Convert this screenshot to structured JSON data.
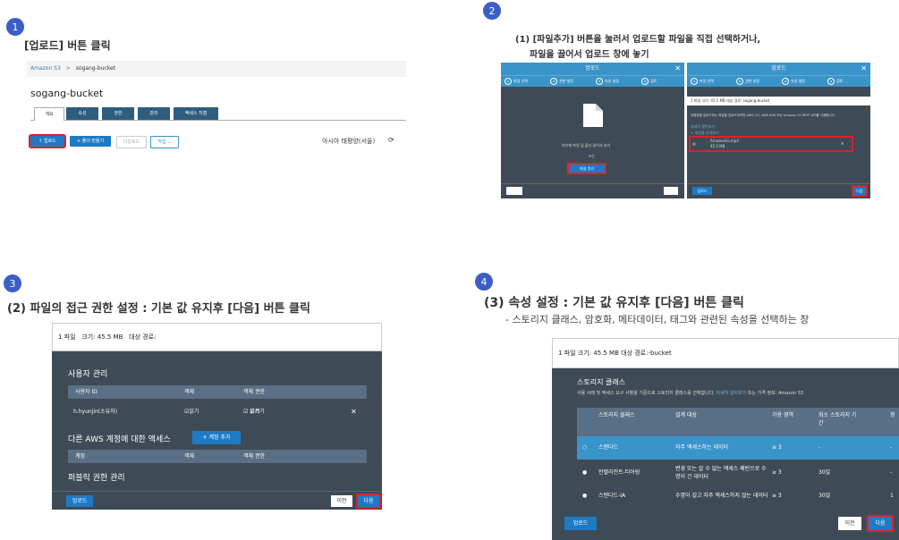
{
  "steps": {
    "s1": {
      "num": "1",
      "heading": "[업로드] 버튼 클릭"
    },
    "s2": {
      "num": "2",
      "line1": "(1) [파일추가] 버튼을 눌러서 업로드할 파일을 직접 선택하거나,",
      "line2": "파일을 끌어서 업로드 창에 놓기"
    },
    "s3": {
      "num": "3",
      "heading": "(2) 파일의 접근 권한 설정 : 기본 값 유지후 [다음] 버튼 클릭"
    },
    "s4": {
      "num": "4",
      "heading": "(3) 속성 설정 : 기본 값 유지후 [다음] 버튼 클릭",
      "sub": "- 스토리지 클래스, 암호화, 메타데이터, 태그와 관련된 속성을 선택하는 창"
    }
  },
  "panel1": {
    "crumb_root": "Amazon S3",
    "crumb_sep": ">",
    "crumb_current": "sogang-bucket",
    "bucket_title": "sogang-bucket",
    "tabs": [
      "개요",
      "속성",
      "권한",
      "관리",
      "액세스 지점"
    ],
    "upload": "업로드",
    "create_folder": "+ 폴더 만들기",
    "download": "다운로드",
    "actions": "작업 ⌄",
    "region": "아시아 태평양(서울)",
    "refresh_icon": "refresh-icon"
  },
  "panel2": {
    "title": "업로드",
    "close": "✕",
    "steps": [
      "파일 선택",
      "권한 설정",
      "속성 설정",
      "검토"
    ],
    "left": {
      "drop_text": "여기에 파일 및 폴더 끌어서 놓기",
      "or": "또는",
      "add_files": "파일 추가",
      "upload_btn": "업로드"
    },
    "right": {
      "info": "1 파일   크기: 45.5 MB   대상 경로: sogang-bucket",
      "desc": "대용량을 업로드하는 파일을 업로드하려면 AWS CLI, AWS SDK 또는 Amazon S3 REST API를 사용합니다.",
      "learn_more": "자세히 알아보기",
      "add_more": "+ 파일을 추가하기",
      "file_name": "AmazonGo.mp4",
      "file_size": "45.5 MB",
      "remove": "✕",
      "upload_btn": "업로드",
      "next_btn": "다음"
    }
  },
  "panel3": {
    "info_files": "1 파일",
    "info_size": "크기: 45.5 MB",
    "info_target": "대상 경로:",
    "user_mgmt": "사용자 관리",
    "cols": [
      "사용자 ID",
      "객체",
      "객체 권한"
    ],
    "user": "h.hyunjin(소유자)",
    "read": "읽기",
    "read2": "읽기",
    "write": "쓰기",
    "remove": "✕",
    "other_accounts": "다른 AWS 계정에 대한 액세스",
    "add_account": "+ 계정 추가",
    "cols2": [
      "계정",
      "객체",
      "객체 권한"
    ],
    "public": "퍼블릭 권한 관리",
    "upload": "업로드",
    "prev": "이전",
    "next": "다음"
  },
  "panel4": {
    "info": "1 파일   크기: 45.5 MB   대상 경로:",
    "info_bucket": "-bucket",
    "storage_class": "스토리지 클래스",
    "desc": "사용 사례 및 액세스 요구 사항을 기준으로 스토리지 클래스를 선택합니다.",
    "learn_more": "자세히 알아보기",
    "desc2": "또는 가격 정보: Amazon S3",
    "cols": [
      "스토리지 클래스",
      "설계 대상",
      "가용 영역",
      "최소 스토리지 기간",
      "청"
    ],
    "rows": [
      {
        "name": "스탠다드",
        "design": "자주 액세스하는 데이터",
        "az": "≥ 3",
        "min": "-",
        "last": "-"
      },
      {
        "name": "인텔리전트-티어링",
        "design": "변경 또는 알 수 없는 액세스 패턴으로 수명이 긴 데이터",
        "az": "≥ 3",
        "min": "30일",
        "last": "-"
      },
      {
        "name": "스탠다드-IA",
        "design": "수명이 길고 자주 액세스하지 않는 데이터",
        "az": "≥ 3",
        "min": "30일",
        "last": "1"
      }
    ],
    "upload": "업로드",
    "prev": "이전",
    "next": "다음"
  }
}
